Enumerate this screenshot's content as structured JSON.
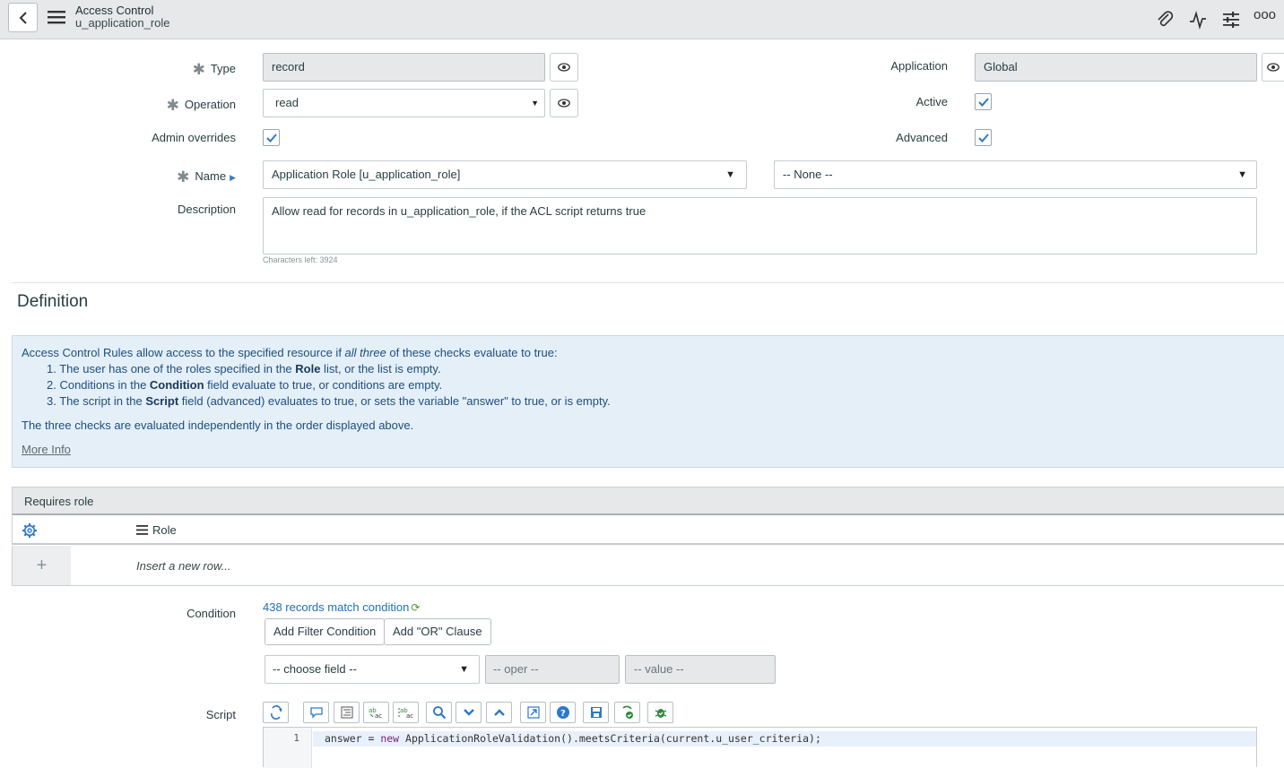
{
  "header": {
    "title": "Access Control",
    "subtitle": "u_application_role",
    "more_label": "ooo"
  },
  "form": {
    "type": {
      "label": "Type",
      "value": "record"
    },
    "operation": {
      "label": "Operation",
      "value": "read"
    },
    "admin_overrides": {
      "label": "Admin overrides",
      "checked": true
    },
    "name": {
      "label": "Name",
      "value": "Application Role [u_application_role]",
      "field_value": "-- None --"
    },
    "description": {
      "label": "Description",
      "value": "Allow read for records in u_application_role, if the ACL script returns true",
      "chars_left": "Characters left: 3924"
    },
    "application": {
      "label": "Application",
      "value": "Global"
    },
    "active": {
      "label": "Active",
      "checked": true
    },
    "advanced": {
      "label": "Advanced",
      "checked": true
    }
  },
  "definition": {
    "title": "Definition",
    "intro_before": "Access Control Rules allow access to the specified resource if ",
    "intro_em": "all three",
    "intro_after": " of these checks evaluate to true:",
    "item1_before": "1. The user has one of the roles specified in the ",
    "item1_bold": "Role",
    "item1_after": " list, or the list is empty.",
    "item2_before": "2. Conditions in the ",
    "item2_bold": "Condition",
    "item2_after": " field evaluate to true, or conditions are empty.",
    "item3_before": "3. The script in the ",
    "item3_bold": "Script",
    "item3_after": " field (advanced) evaluates to true, or sets the variable \"answer\" to true, or is empty.",
    "footer": "The three checks are evaluated independently in the order displayed above.",
    "more_info": "More Info"
  },
  "roles": {
    "title": "Requires role",
    "column": "Role",
    "insert": "Insert a new row..."
  },
  "condition": {
    "label": "Condition",
    "match_text": "438 records match condition",
    "add_filter": "Add Filter Condition",
    "add_or": "Add \"OR\" Clause",
    "choose_field": "-- choose field --",
    "oper": "-- oper --",
    "value": "-- value --"
  },
  "script": {
    "label": "Script",
    "line_number": "1",
    "code_before": "answer = ",
    "code_keyword": "new",
    "code_after": " ApplicationRoleValidation().meetsCriteria(current.u_user_criteria);"
  },
  "colors": {
    "header_bg": "#e6e8ea",
    "info_bg": "#e4eff8",
    "link": "#1f6fb5",
    "checkbox_tick": "#2c79c7"
  }
}
